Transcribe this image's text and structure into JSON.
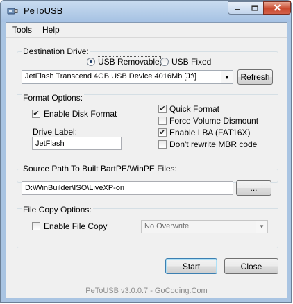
{
  "window": {
    "title": "PeToUSB",
    "icon": "usb-drive-icon"
  },
  "menu": {
    "tools": "Tools",
    "help": "Help"
  },
  "destination": {
    "group_label": "Destination Drive:",
    "usb_removable": "USB Removable",
    "usb_fixed": "USB Fixed",
    "selected_type": "USB Removable",
    "drive_value": "JetFlash Transcend 4GB USB Device 4016Mb [J:\\]",
    "refresh": "Refresh"
  },
  "format": {
    "group_label": "Format Options:",
    "enable_disk_format": "Enable Disk Format",
    "enable_disk_format_checked": true,
    "drive_label_caption": "Drive Label:",
    "drive_label_value": "JetFlash",
    "quick_format": "Quick Format",
    "quick_format_checked": true,
    "force_dismount": "Force Volume Dismount",
    "force_dismount_checked": false,
    "enable_lba": "Enable LBA (FAT16X)",
    "enable_lba_checked": true,
    "dont_rewrite_mbr": "Don't rewrite MBR code",
    "dont_rewrite_mbr_checked": false
  },
  "source": {
    "group_label": "Source Path To Built BartPE/WinPE Files:",
    "path_value": "D:\\WinBuilder\\ISO\\LiveXP-ori",
    "browse": "..."
  },
  "file_copy": {
    "group_label": "File Copy Options:",
    "enable_file_copy": "Enable File Copy",
    "enable_file_copy_checked": false,
    "overwrite_value": "No Overwrite"
  },
  "actions": {
    "start": "Start",
    "close": "Close"
  },
  "status": "PeToUSB v3.0.0.7 - GoCoding.Com",
  "colors": {
    "title_bar": "#b9d1ea",
    "close_button": "#c94a2e",
    "dialog_bg": "#f0f0f0",
    "default_button_border": "#3c7fb1"
  }
}
